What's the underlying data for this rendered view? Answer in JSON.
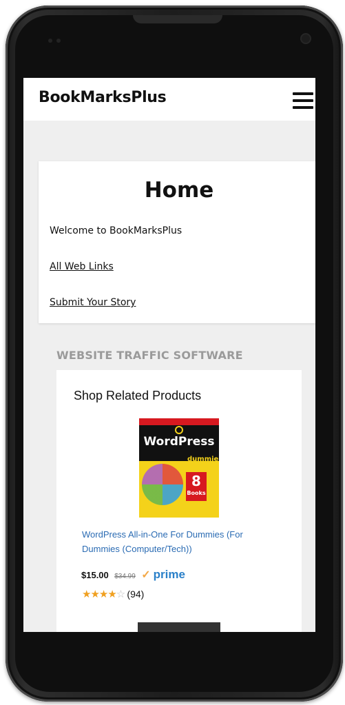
{
  "header": {
    "brand": "BookMarksPlus",
    "menu_icon": "hamburger-icon"
  },
  "home_card": {
    "title": "Home",
    "welcome": "Welcome to BookMarksPlus",
    "links": [
      "All Web Links",
      "Submit Your Story"
    ]
  },
  "sidebar_widget": {
    "heading": "WEBSITE TRAFFIC SOFTWARE",
    "shop_title": "Shop Related Products",
    "product": {
      "cover_title": "WordPress",
      "cover_series": "dummies",
      "cover_badge_number": "8",
      "cover_badge_text": "Books",
      "title": "WordPress All-in-One For Dummies (For Dummies (Computer/Tech))",
      "price": "$15.00",
      "list_price": "$34.99",
      "prime_label": "prime",
      "rating_stars": 4,
      "rating_max": 5,
      "review_count": "(94)"
    }
  },
  "colors": {
    "link": "#2a6bb3",
    "section_heading": "#9a9a9a",
    "prime": "#2a80c9",
    "star": "#f0a020"
  }
}
